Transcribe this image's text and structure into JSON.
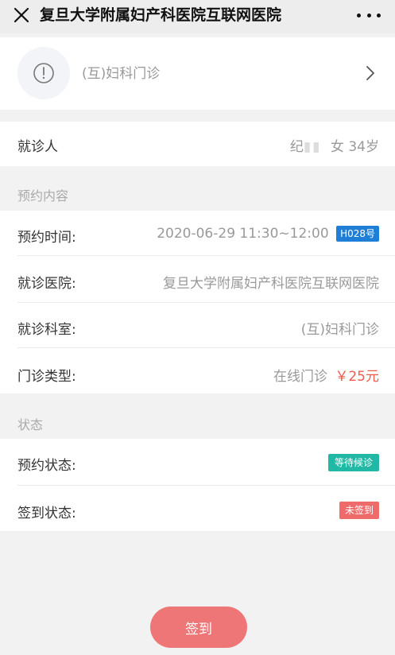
{
  "header": {
    "title": "复旦大学附属妇产科医院互联网医院",
    "close_icon": "close-icon",
    "more_icon": "more-dots-icon"
  },
  "department_card": {
    "icon": "info-circle-icon",
    "name": "(互)妇科门诊",
    "arrow_icon": "chevron-right-icon"
  },
  "patient": {
    "label": "就诊人",
    "name": "纪",
    "name_masked": "▮▮",
    "gender_age": "女 34岁"
  },
  "appointment_section": {
    "title": "预约内容",
    "time_label": "预约时间:",
    "time_value": "2020-06-29 11:30~12:00",
    "number_tag": "H028号",
    "hospital_label": "就诊医院:",
    "hospital_value": "复旦大学附属妇产科医院互联网医院",
    "dept_label": "就诊科室:",
    "dept_value": "(互)妇科门诊",
    "type_label": "门诊类型:",
    "type_value": "在线门诊",
    "price": "￥25元"
  },
  "status_section": {
    "title": "状态",
    "appointment_status_label": "预约状态:",
    "appointment_status_value": "等待候诊",
    "signin_status_label": "签到状态:",
    "signin_status_value": "未签到"
  },
  "signin_button": "签到",
  "colors": {
    "accent_blue": "#1f7fd6",
    "status_teal": "#22b8a6",
    "status_red": "#ef6a6a",
    "price_red": "#f05a4b",
    "button_red": "#ef7676"
  }
}
